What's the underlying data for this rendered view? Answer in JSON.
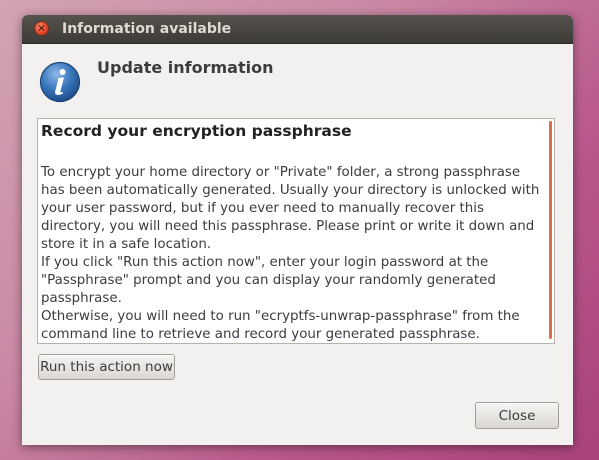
{
  "window": {
    "title": "Information available",
    "close_glyph": "×"
  },
  "header": {
    "icon": "info-icon",
    "heading": "Update information"
  },
  "content": {
    "title": "Record your encryption passphrase",
    "paragraphs": [
      "To encrypt your home directory or \"Private\" folder, a strong passphrase has been automatically generated. Usually your directory is unlocked with your user password, but if you ever need to manually recover this directory, you will need this passphrase. Please print or write it down and store it in a safe location.",
      "If you click \"Run this action now\", enter your login password at the \"Passphrase\" prompt and you can display your randomly generated passphrase.",
      "Otherwise, you will need to run \"ecryptfs-unwrap-passphrase\" from the command line to retrieve and record your generated passphrase."
    ]
  },
  "buttons": {
    "run_action": "Run this action now",
    "close": "Close"
  },
  "colors": {
    "accent_scrollbar": "#dd6d42",
    "titlebar": "#3d3b37",
    "info_icon_blue": "#2f6fb0"
  }
}
